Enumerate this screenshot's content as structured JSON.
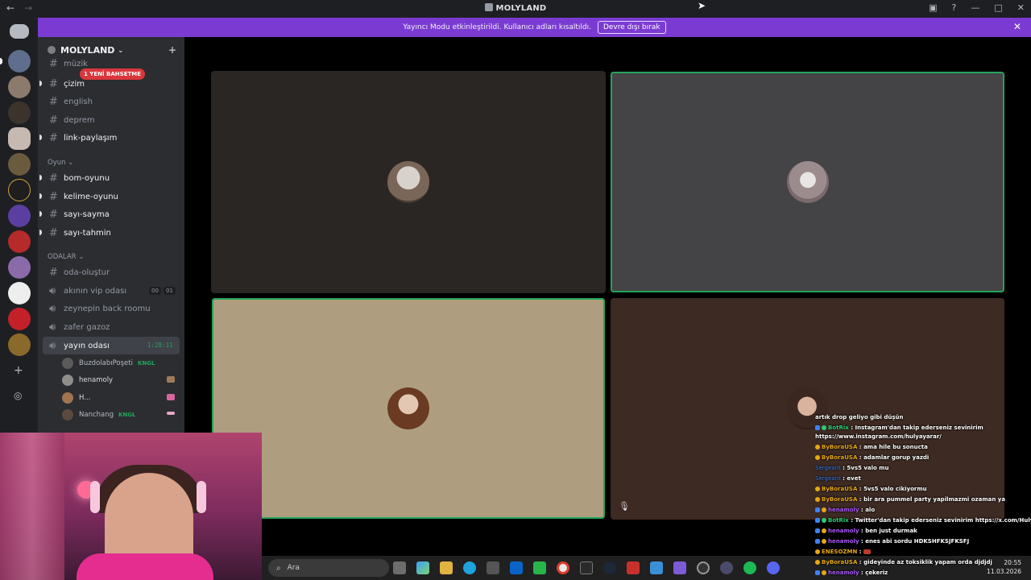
{
  "titlebar": {
    "title": "MOLYLAND"
  },
  "banner": {
    "text": "Yayıncı Modu etkinleştirildi. Kullanıcı adları kısaltıldı.",
    "button": "Devre dışı bırak"
  },
  "server": {
    "name": "MOLYLAND"
  },
  "mention_badge": "1 YENİ BAHSETME",
  "channels": [
    {
      "name": "müzik"
    },
    {
      "name": "çizim"
    },
    {
      "name": "english"
    },
    {
      "name": "deprem"
    },
    {
      "name": "link-paylaşım"
    }
  ],
  "category_game": "Oyun",
  "game_channels": [
    {
      "name": "bom-oyunu"
    },
    {
      "name": "kelime-oyunu"
    },
    {
      "name": "sayı-sayma"
    },
    {
      "name": "sayı-tahmin"
    }
  ],
  "category_rooms": "ODALAR",
  "rooms": [
    {
      "name": "oda-oluştur"
    },
    {
      "name": "akının vip odası",
      "c1": "00",
      "c2": "01"
    },
    {
      "name": "zeynepin back roomu"
    },
    {
      "name": "zafer gazoz"
    },
    {
      "name": "yayın odası",
      "timer": "1:28:11"
    }
  ],
  "voice_users": [
    {
      "name": "BuzdolabıPoşeti",
      "tag": "KNGL"
    },
    {
      "name": "henamoly"
    },
    {
      "name": "H..."
    },
    {
      "name": "Nanchang",
      "tag": "KNGL"
    }
  ],
  "taskbar": {
    "search_placeholder": "Ara",
    "time": "20:55",
    "date": "11.03.2026"
  },
  "chat": [
    {
      "user": "",
      "text": "artık drop geliyo gibi düşün",
      "color": "#5865f2"
    },
    {
      "user": "BotRix",
      "text": "Instagram'dan takip ederseniz sevinirim",
      "color": "#2ecc71"
    },
    {
      "user": "",
      "text": "https://www.instagram.com/hulyayarar/",
      "color": "#ffffff"
    },
    {
      "user": "ByBoraUSA",
      "text": "ama hile bu sonucta",
      "color": "#e6a817"
    },
    {
      "user": "ByBoraUSA",
      "text": "adamlar gorup yazdi",
      "color": "#e6a817"
    },
    {
      "user": "Sergeant",
      "text": "5vs5 valo mu",
      "color": "#3b82f6"
    },
    {
      "user": "Sergeant",
      "text": "evet",
      "color": "#3b82f6"
    },
    {
      "user": "ByBoraUSA",
      "text": "5vs5 valo cikiyormu",
      "color": "#e6a817"
    },
    {
      "user": "ByBoraUSA",
      "text": "bir ara pummel party yapilmazmi ozaman ya",
      "color": "#e6a817"
    },
    {
      "user": "henamoly",
      "text": "alo",
      "color": "#a855f7"
    },
    {
      "user": "BotRix",
      "text": "Twitter'dan takip ederseniz sevinirim https://x.com/Hulya_yarar",
      "color": "#2ecc71"
    },
    {
      "user": "henamoly",
      "text": "ben just durmak",
      "color": "#a855f7"
    },
    {
      "user": "henamoly",
      "text": "enes abi sordu HDKSHFKSJFKSFJ",
      "color": "#a855f7"
    },
    {
      "user": "ENESOZMN",
      "text": "",
      "color": "#e6a817"
    },
    {
      "user": "ByBoraUSA",
      "text": "gideyinde az toksiklik yapam orda djdjdj",
      "color": "#e6a817"
    },
    {
      "user": "henamoly",
      "text": "çekeriz",
      "color": "#a855f7"
    }
  ]
}
